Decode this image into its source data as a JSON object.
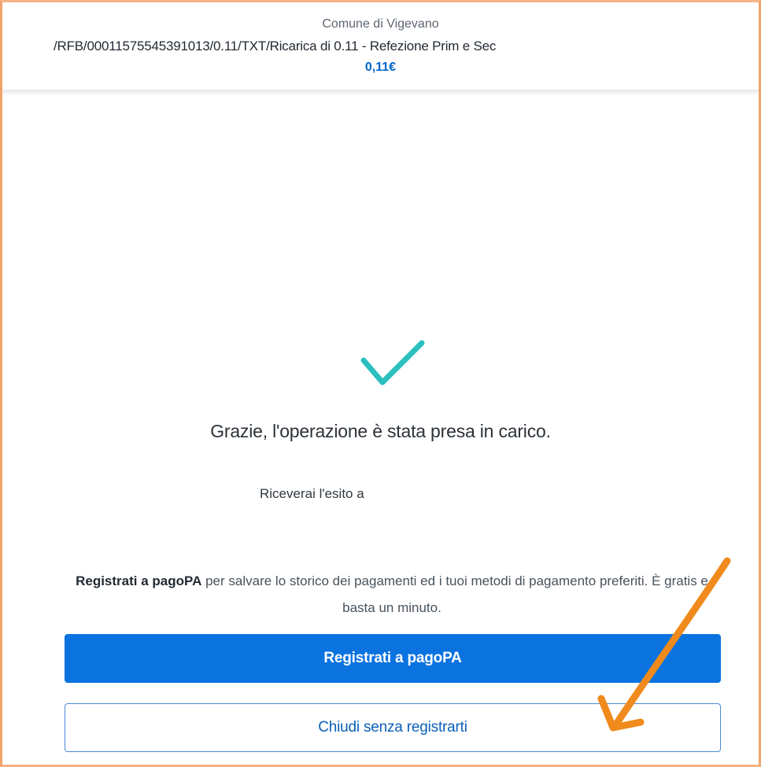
{
  "header": {
    "merchant": "Comune di Vigevano",
    "description": "/RFB/00011575545391013/0.11/TXT/Ricarica di 0.11 - Refezione Prim e Sec",
    "amount": "0,11€"
  },
  "confirmation": {
    "icon": "check-icon",
    "title": "Grazie, l'operazione è stata presa in carico.",
    "outcome_label": "Riceverai l'esito a"
  },
  "promo": {
    "link_text": "Registrati a pagoPA",
    "text": " per salvare lo storico dei pagamenti ed i tuoi metodi di pagamento preferiti. È gratis e basta un minuto."
  },
  "actions": {
    "register_label": "Registrati a pagoPA",
    "close_label": "Chiudi senza registrarti"
  },
  "colors": {
    "primary": "#0b73e0",
    "check": "#2bbfbf",
    "annotation": "#f08a1c"
  }
}
